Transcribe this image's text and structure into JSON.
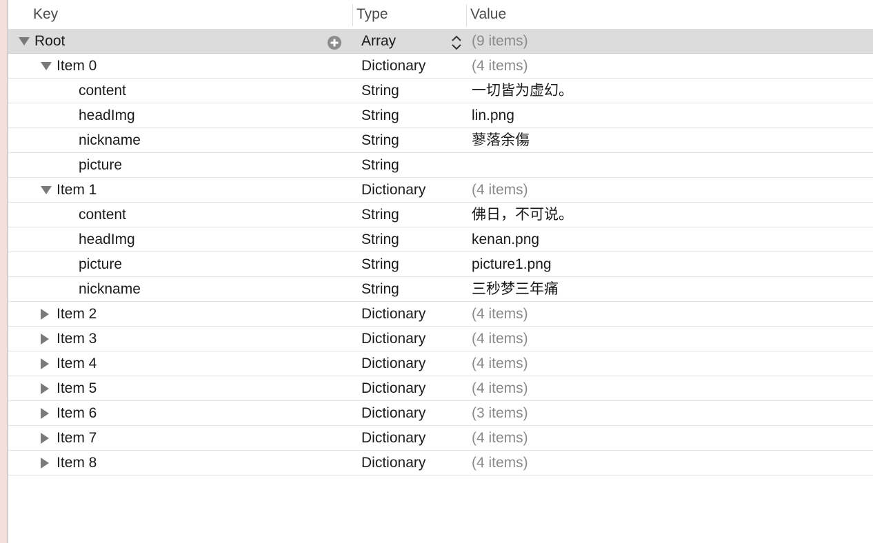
{
  "header": {
    "key_label": "Key",
    "type_label": "Type",
    "value_label": "Value"
  },
  "root": {
    "key": "Root",
    "type": "Array",
    "value": "(9 items)",
    "expanded": true,
    "add_icon": "plus-circle-icon",
    "type_stepper_icon": "up-down-chevron-icon"
  },
  "rows": [
    {
      "key": "Item 0",
      "type": "Dictionary",
      "value": "(4 items)",
      "level": 1,
      "disclosure": "expanded",
      "muted": true
    },
    {
      "key": "content",
      "type": "String",
      "value": "一切皆为虚幻。",
      "level": 2,
      "disclosure": "none",
      "muted": false
    },
    {
      "key": "headImg",
      "type": "String",
      "value": "lin.png",
      "level": 2,
      "disclosure": "none",
      "muted": false
    },
    {
      "key": "nickname",
      "type": "String",
      "value": "蓼落余傷",
      "level": 2,
      "disclosure": "none",
      "muted": false
    },
    {
      "key": "picture",
      "type": "String",
      "value": "",
      "level": 2,
      "disclosure": "none",
      "muted": false
    },
    {
      "key": "Item 1",
      "type": "Dictionary",
      "value": "(4 items)",
      "level": 1,
      "disclosure": "expanded",
      "muted": true
    },
    {
      "key": "content",
      "type": "String",
      "value": "佛日，不可说。",
      "level": 2,
      "disclosure": "none",
      "muted": false
    },
    {
      "key": "headImg",
      "type": "String",
      "value": "kenan.png",
      "level": 2,
      "disclosure": "none",
      "muted": false
    },
    {
      "key": "picture",
      "type": "String",
      "value": "picture1.png",
      "level": 2,
      "disclosure": "none",
      "muted": false
    },
    {
      "key": "nickname",
      "type": "String",
      "value": "三秒梦三年痛",
      "level": 2,
      "disclosure": "none",
      "muted": false
    },
    {
      "key": "Item 2",
      "type": "Dictionary",
      "value": "(4 items)",
      "level": 1,
      "disclosure": "collapsed",
      "muted": true
    },
    {
      "key": "Item 3",
      "type": "Dictionary",
      "value": "(4 items)",
      "level": 1,
      "disclosure": "collapsed",
      "muted": true
    },
    {
      "key": "Item 4",
      "type": "Dictionary",
      "value": "(4 items)",
      "level": 1,
      "disclosure": "collapsed",
      "muted": true
    },
    {
      "key": "Item 5",
      "type": "Dictionary",
      "value": "(4 items)",
      "level": 1,
      "disclosure": "collapsed",
      "muted": true
    },
    {
      "key": "Item 6",
      "type": "Dictionary",
      "value": "(3 items)",
      "level": 1,
      "disclosure": "collapsed",
      "muted": true
    },
    {
      "key": "Item 7",
      "type": "Dictionary",
      "value": "(4 items)",
      "level": 1,
      "disclosure": "collapsed",
      "muted": true
    },
    {
      "key": "Item 8",
      "type": "Dictionary",
      "value": "(4 items)",
      "level": 1,
      "disclosure": "collapsed",
      "muted": true
    }
  ],
  "colors": {
    "root_row_bg": "#dcdcdc",
    "muted_value": "#8a8a8a",
    "text": "#1a1a1a",
    "disclosure": "#7a7a7a",
    "left_strip": "#f6dedd"
  }
}
